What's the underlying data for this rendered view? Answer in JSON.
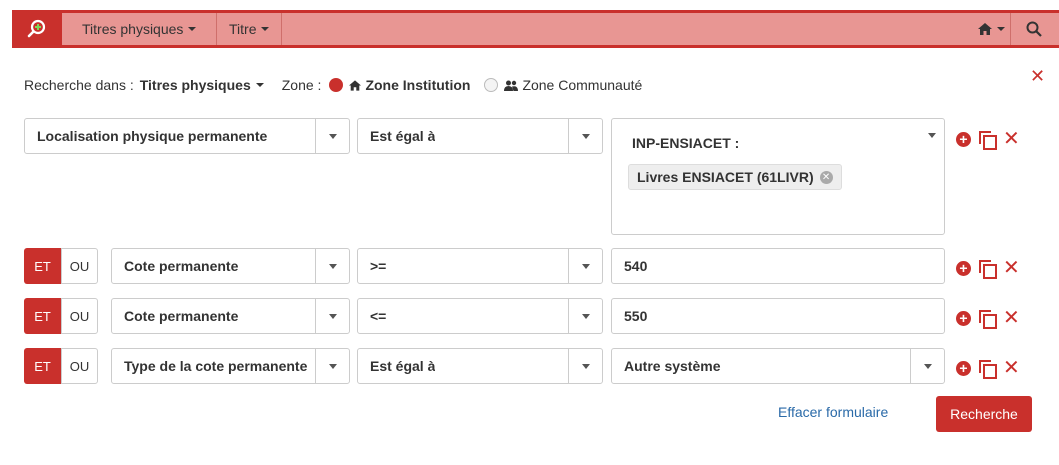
{
  "nav": {
    "logo_icon": "search-plus-icon",
    "item1": "Titres physiques",
    "item2": "Titre",
    "home_icon": "home-icon",
    "search_icon": "search-icon"
  },
  "scope": {
    "label": "Recherche dans :",
    "value": "Titres physiques",
    "zone_label": "Zone :",
    "zone_institution": "Zone Institution",
    "zone_community": "Zone Communauté"
  },
  "rows": [
    {
      "field": "Localisation physique permanente",
      "operator": "Est égal à",
      "group": "INP-ENSIACET :",
      "tag": "Livres ENSIACET (61LIVR)"
    },
    {
      "conj_and": "ET",
      "conj_or": "OU",
      "field": "Cote permanente",
      "operator": ">=",
      "value": "540"
    },
    {
      "conj_and": "ET",
      "conj_or": "OU",
      "field": "Cote permanente",
      "operator": "<=",
      "value": "550"
    },
    {
      "conj_and": "ET",
      "conj_or": "OU",
      "field": "Type de la cote permanente",
      "operator": "Est égal à",
      "value": "Autre système"
    }
  ],
  "actions": {
    "clear": "Effacer formulaire",
    "search": "Recherche"
  },
  "colors": {
    "accent": "#c9302c",
    "nav_bg": "#e89693",
    "link": "#2a6aa8"
  }
}
